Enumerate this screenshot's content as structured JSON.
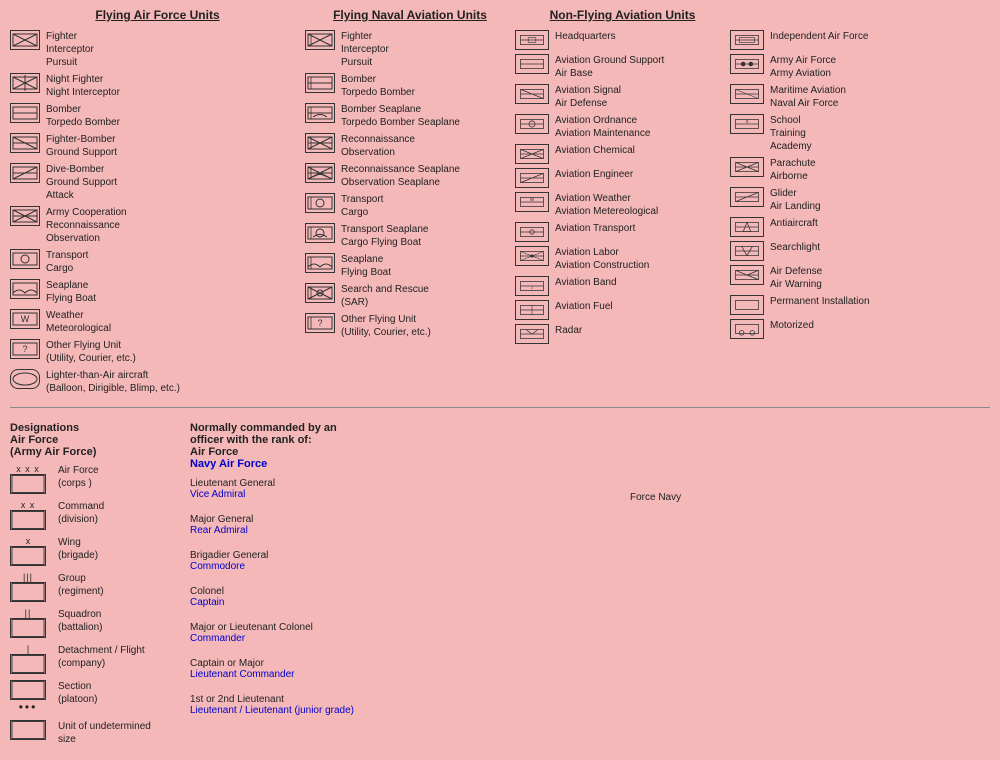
{
  "sections": {
    "col1_title": "Flying Air Force Units",
    "col2_title": "Flying Naval Aviation Units",
    "col3_title": "Non-Flying Aviation Units",
    "col4_title": ""
  },
  "flying_af": [
    {
      "label": "Fighter\nInterceptor\nPursuit"
    },
    {
      "label": "Night Fighter\nNight Interceptor"
    },
    {
      "label": "Bomber\nTorpedo Bomber"
    },
    {
      "label": "Fighter-Bomber\nGround Support"
    },
    {
      "label": "Dive-Bomber\nGround Support\nAttack"
    },
    {
      "label": "Army Cooperation\nReconnaissance\nObservation"
    },
    {
      "label": "Transport\nCargo"
    },
    {
      "label": "Seaplane\nFlying Boat"
    },
    {
      "label": "Weather\nMeteorological"
    },
    {
      "label": "Other Flying Unit\n(Utility, Courier, etc.)"
    },
    {
      "label": "Lighter-than-Air aircraft\n(Balloon, Dirigible, Blimp, etc.)"
    }
  ],
  "flying_nav": [
    {
      "label": "Fighter\nInterceptor\nPursuit"
    },
    {
      "label": "Bomber\nTorpedo Bomber"
    },
    {
      "label": "Bomber Seaplane\nTorpedo Bomber Seaplane"
    },
    {
      "label": "Reconnaissance\nObservation"
    },
    {
      "label": "Reconnaissance Seaplane\nObservation Seaplane"
    },
    {
      "label": "Transport\nCargo"
    },
    {
      "label": "Transport Seaplane\nCargo Flying Boat"
    },
    {
      "label": "Seaplane\nFlying Boat"
    },
    {
      "label": "Search and Rescue\n(SAR)"
    },
    {
      "label": "Other Flying Unit\n(Utility, Courier, etc.)"
    }
  ],
  "non_flying": [
    {
      "label": "Headquarters"
    },
    {
      "label": "Aviation Ground Support\nAir Base"
    },
    {
      "label": "Aviation Signal\nAir Defense"
    },
    {
      "label": "Aviation Ordnance\nAviation Maintenance"
    },
    {
      "label": "Aviation Chemical"
    },
    {
      "label": "Aviation Engineer"
    },
    {
      "label": "Aviation Weather\nAviation Metereological"
    },
    {
      "label": "Aviation Transport"
    },
    {
      "label": "Aviation Labor\nAviation Construction"
    },
    {
      "label": "Aviation Band"
    },
    {
      "label": "Aviation Fuel"
    },
    {
      "label": "Radar"
    }
  ],
  "non_flying_col4": [
    {
      "label": "Independent Air Force"
    },
    {
      "label": "Army Air Force\nArmy Aviation"
    },
    {
      "label": "Maritime Aviation\nNaval Air Force"
    },
    {
      "label": "School\nTraining\nAcademy"
    },
    {
      "label": "Parachute\nAirborne"
    },
    {
      "label": "Glider\nAir Landing"
    },
    {
      "label": "Antiaircraft"
    },
    {
      "label": "Searchlight"
    },
    {
      "label": "Air Defense\nAir Warning"
    },
    {
      "label": "Permanent Installation"
    },
    {
      "label": "Motorized"
    }
  ],
  "designations": {
    "title": "Designations",
    "subtitle": "Air Force",
    "subtitle2": "(Army Air Force)",
    "items": [
      {
        "symbol": "xxx",
        "label": "Air Force\n(corps )"
      },
      {
        "symbol": "xx",
        "label": "Command\n(division)"
      },
      {
        "symbol": "x",
        "label": "Wing\n(brigade)"
      },
      {
        "symbol": "iii",
        "label": "Group\n(regiment)"
      },
      {
        "symbol": "ii",
        "label": "Squadron\n(battalion)"
      },
      {
        "symbol": "i",
        "label": "Detachment / Flight\n(company)"
      },
      {
        "symbol": "dot",
        "label": "Section\n(platoon)"
      },
      {
        "symbol": "box",
        "label": "Unit of undetermined size"
      }
    ]
  },
  "ranks": {
    "title_line1": "Normally commanded by an",
    "title_line2": "officer with the rank of:",
    "title_af": "Air Force",
    "title_nav": "Navy Air Force",
    "items": [
      {
        "army": "Lieutenant General",
        "navy": "Vice Admiral"
      },
      {
        "army": "Major General",
        "navy": "Rear Admiral"
      },
      {
        "army": "Brigadier General",
        "navy": "Commodore"
      },
      {
        "army": "Colonel",
        "navy": "Captain"
      },
      {
        "army": "Major or Lieutenant Colonel",
        "navy": "Commander"
      },
      {
        "army": "Captain or Major",
        "navy": "Lieutenant Commander"
      },
      {
        "army": "1st or 2nd Lieutenant",
        "navy": "Lieutenant / Lieutenant (junior grade)"
      },
      {
        "army": "",
        "navy": ""
      }
    ]
  }
}
